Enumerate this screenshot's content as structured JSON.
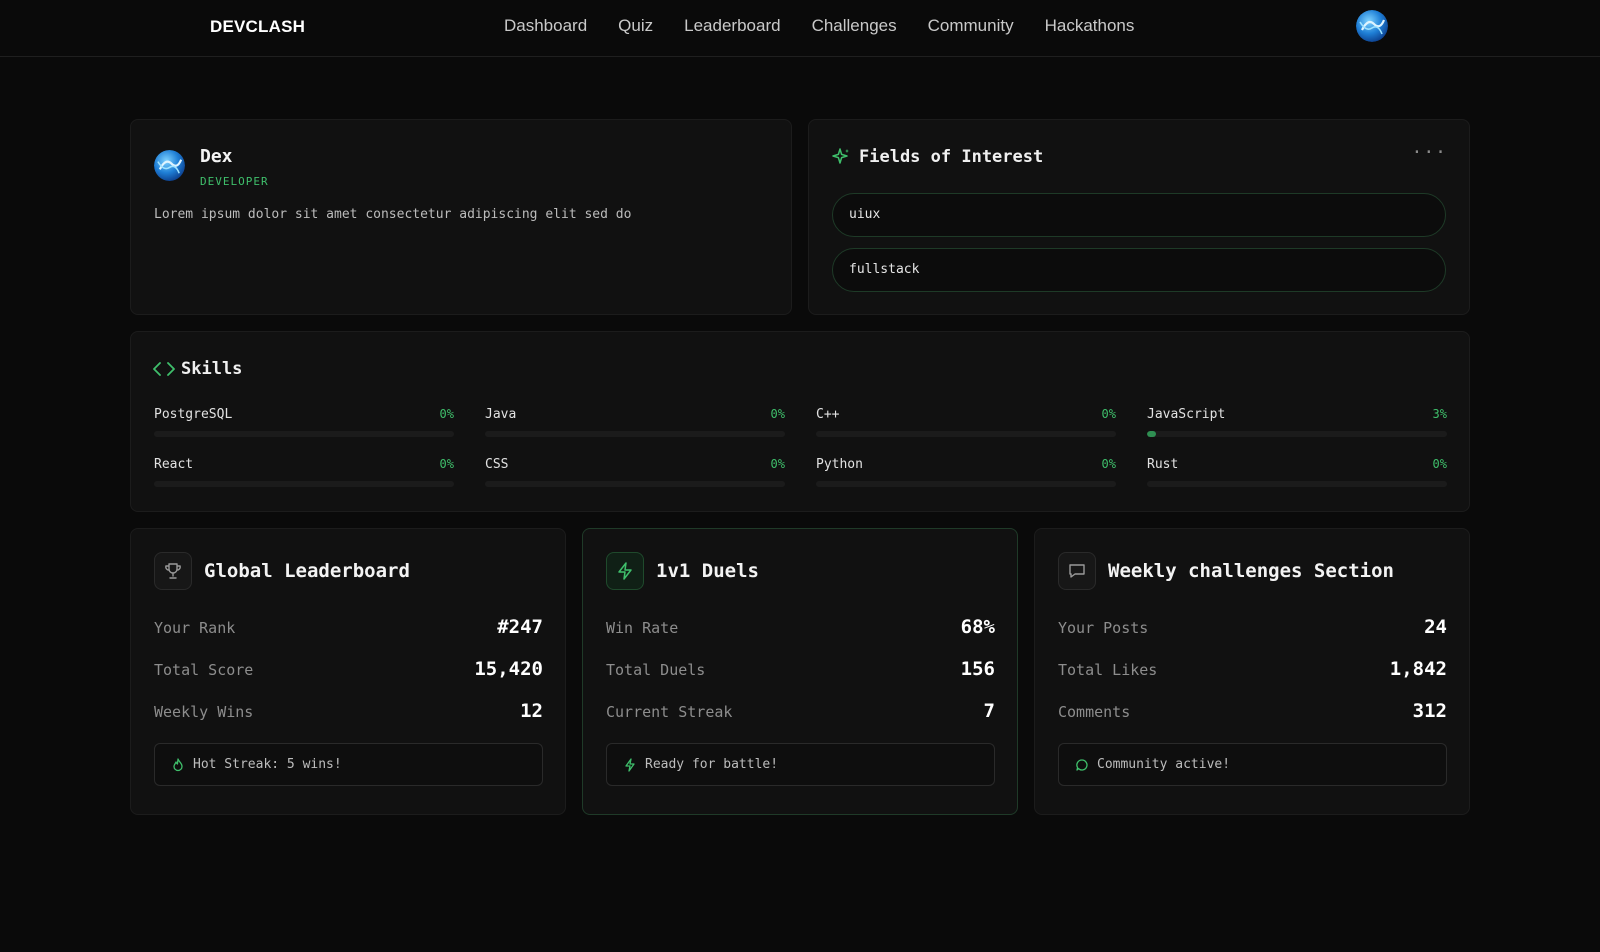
{
  "nav": {
    "brand": "DEVCLASH",
    "links": [
      "Dashboard",
      "Quiz",
      "Leaderboard",
      "Challenges",
      "Community",
      "Hackathons"
    ]
  },
  "profile": {
    "name": "Dex",
    "role": "DEVELOPER",
    "bio": "Lorem ipsum dolor sit amet consectetur adipiscing elit sed do"
  },
  "interests": {
    "title": "Fields of Interest",
    "menu": "···",
    "items": [
      "uiux",
      "fullstack"
    ]
  },
  "skills": {
    "title": "Skills",
    "items": [
      {
        "name": "PostgreSQL",
        "pct_label": "0%",
        "value": 0
      },
      {
        "name": "Java",
        "pct_label": "0%",
        "value": 0
      },
      {
        "name": "C++",
        "pct_label": "0%",
        "value": 0
      },
      {
        "name": "JavaScript",
        "pct_label": "3%",
        "value": 3
      },
      {
        "name": "React",
        "pct_label": "0%",
        "value": 0
      },
      {
        "name": "CSS",
        "pct_label": "0%",
        "value": 0
      },
      {
        "name": "Python",
        "pct_label": "0%",
        "value": 0
      },
      {
        "name": "Rust",
        "pct_label": "0%",
        "value": 0
      }
    ]
  },
  "leaderboard": {
    "title": "Global Leaderboard",
    "icon": "trophy-icon",
    "rows": [
      {
        "label": "Your Rank",
        "value": "#247"
      },
      {
        "label": "Total Score",
        "value": "15,420"
      },
      {
        "label": "Weekly Wins",
        "value": "12"
      }
    ],
    "footer": "Hot Streak: 5 wins!"
  },
  "duels": {
    "title": "1v1 Duels",
    "icon": "lightning-icon",
    "rows": [
      {
        "label": "Win Rate",
        "value": "68%"
      },
      {
        "label": "Total Duels",
        "value": "156"
      },
      {
        "label": "Current Streak",
        "value": "7"
      }
    ],
    "footer": "Ready for battle!"
  },
  "weekly": {
    "title": "Weekly challenges Section",
    "icon": "message-icon",
    "rows": [
      {
        "label": "Your Posts",
        "value": "24"
      },
      {
        "label": "Total Likes",
        "value": "1,842"
      },
      {
        "label": "Comments",
        "value": "312"
      }
    ],
    "footer": "Community active!"
  },
  "colors": {
    "accent": "#3fbf6b",
    "background": "#0a0a0a",
    "card": "#111111"
  }
}
